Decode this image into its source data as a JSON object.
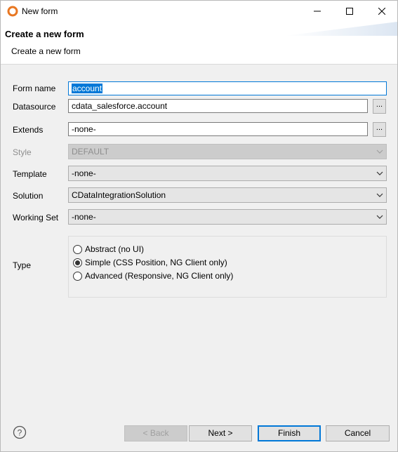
{
  "window": {
    "title": "New form",
    "icon": "servoy-ring-icon",
    "accent": "#e87722"
  },
  "banner": {
    "title": "Create a new form",
    "subtitle": "Create a new form"
  },
  "form": {
    "form_name": {
      "label": "Form name",
      "value": "account"
    },
    "datasource": {
      "label": "Datasource",
      "value": "cdata_salesforce.account",
      "browse": "..."
    },
    "extends": {
      "label": "Extends",
      "value": "-none-",
      "browse": "..."
    },
    "style": {
      "label": "Style",
      "value": "DEFAULT"
    },
    "template": {
      "label": "Template",
      "value": "-none-"
    },
    "solution": {
      "label": "Solution",
      "value": "CDataIntegrationSolution"
    },
    "working_set": {
      "label": "Working Set",
      "value": "-none-"
    },
    "type": {
      "label": "Type",
      "options": [
        {
          "label": "Abstract (no UI)",
          "checked": false
        },
        {
          "label": "Simple (CSS Position, NG Client only)",
          "checked": true
        },
        {
          "label": "Advanced (Responsive, NG Client only)",
          "checked": false
        }
      ]
    }
  },
  "footer": {
    "back": "< Back",
    "next": "Next >",
    "finish": "Finish",
    "cancel": "Cancel"
  }
}
